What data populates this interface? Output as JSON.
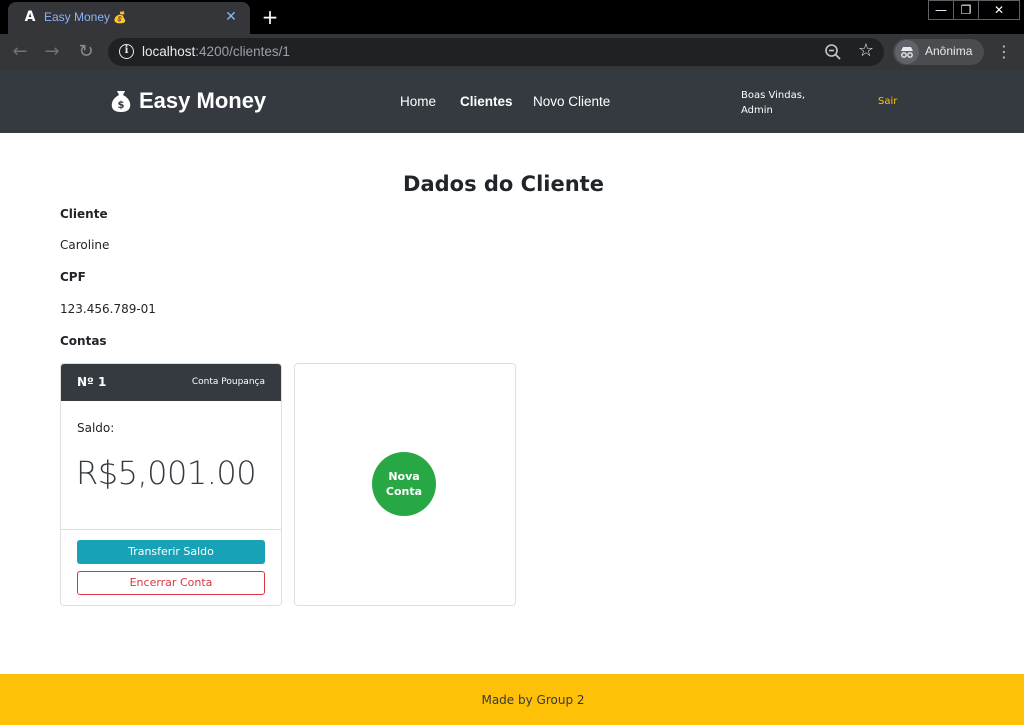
{
  "browser": {
    "tab_title": "Easy Money",
    "tab_emoji": "💰",
    "tab_favicon": "A",
    "url_host": "localhost",
    "url_rest": ":4200/clientes/1",
    "profile_label": "Anônima",
    "icons": [
      "angular-favicon",
      "close-icon",
      "plus-icon",
      "back-arrow-icon",
      "forward-arrow-icon",
      "reload-icon",
      "info-icon",
      "zoom-out-icon",
      "star-icon",
      "incognito-icon",
      "kebab-menu-icon",
      "minimize-icon",
      "maximize-icon",
      "window-close-icon"
    ]
  },
  "navbar": {
    "brand": "Easy Money",
    "brand_icon": "money-bag-icon",
    "links": [
      {
        "label": "Home",
        "active": false
      },
      {
        "label": "Clientes",
        "active": true
      },
      {
        "label": "Novo Cliente",
        "active": false
      }
    ],
    "greeting": "Boas Vindas, Admin",
    "logout": "Sair",
    "colors": {
      "background": "#343a40",
      "logout": "#ffc107"
    }
  },
  "main": {
    "title": "Dados do Cliente",
    "client_label": "Cliente",
    "client_name": "Caroline",
    "cpf_label": "CPF",
    "cpf_value": "123.456.789-01",
    "accounts_label": "Contas",
    "accounts": [
      {
        "number": "Nº 1",
        "type": "Conta Poupança",
        "balance_label": "Saldo:",
        "balance": "R$5,001.00",
        "transfer_label": "Transferir Saldo",
        "close_label": "Encerrar Conta"
      }
    ],
    "new_account_label": "Nova Conta",
    "colors": {
      "transfer": "#17a2b8",
      "close": "#dc3545",
      "new_account": "#28a745"
    }
  },
  "footer": {
    "text": "Made by Group 2",
    "color": "#ffc107"
  }
}
